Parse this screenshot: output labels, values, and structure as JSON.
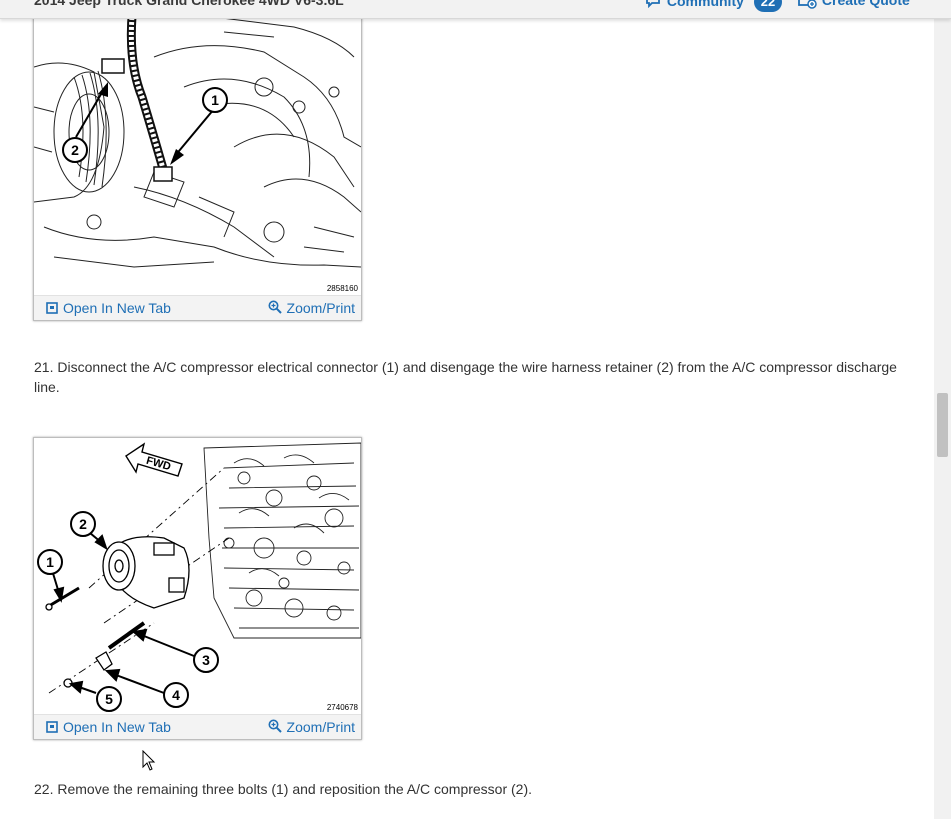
{
  "header": {
    "vehicle_title": "2014 Jeep Truck Grand Cherokee 4WD V6-3.6L",
    "community_label": "Community",
    "community_count": "22",
    "create_quote_label": "Create Quote"
  },
  "figures": [
    {
      "image_id": "2858160",
      "open_label": "Open In New Tab",
      "zoom_label": "Zoom/Print",
      "callouts": [
        "1",
        "2"
      ]
    },
    {
      "image_id": "2740678",
      "open_label": "Open In New Tab",
      "zoom_label": "Zoom/Print",
      "callouts": [
        "1",
        "2",
        "3",
        "4",
        "5"
      ],
      "fwd_label": "FWD"
    }
  ],
  "steps": [
    "21. Disconnect the A/C compressor electrical connector (1) and disengage the wire harness retainer (2) from the A/C compressor discharge line.",
    "22. Remove the remaining three bolts (1) and reposition the A/C compressor (2)."
  ],
  "colors": {
    "link": "#1f6fb5",
    "text": "#333333",
    "toolbar_bg": "#f3f3f3"
  }
}
